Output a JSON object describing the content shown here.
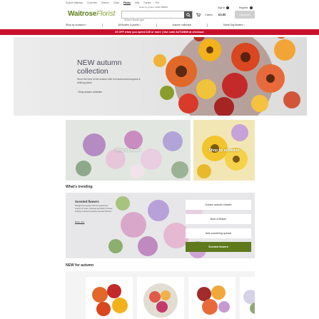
{
  "utility_links": [
    "Explore Waitrose",
    "Groceries",
    "Kitchen",
    "Cellar",
    "Florist",
    "Gifts",
    "Garden",
    "Pet"
  ],
  "utility_active_index": 4,
  "header": {
    "logo_main": "Waitrose",
    "logo_sub": "Florist",
    "order_phone": "Order by phone: 0800 188881",
    "search_placeholder": "Search flower type",
    "items_label": "0 items",
    "basket_total": "£0.00",
    "checkout_label": "Checkout",
    "signin_label": "Sign in",
    "register_label": "Register"
  },
  "nav": {
    "items": [
      {
        "label": "Shop by occasion"
      },
      {
        "label": "All flowers & plants"
      },
      {
        "label": "Autumn collection"
      },
      {
        "label": "Same Day flowers"
      }
    ]
  },
  "promo": "£5 OFF when you spend £35 or more | Use code AUTUMN5 at checkout",
  "hero": {
    "title_line1": "NEW autumn",
    "title_line2": "collection",
    "subtitle": "Send the best of the season with rich autumnal bouquets & striking plants",
    "link": "Shop autumn collection"
  },
  "tiles": [
    {
      "label": "Shop by flower"
    },
    {
      "label": "Shop by occasion"
    }
  ],
  "trending": {
    "section_title": "What's trending",
    "card_title": "Scented flowers",
    "card_desc": "Delight the senses with the perfumed scents of roses, freesias and lilies in these striking, heady & popular scented flowers.",
    "shop_now": "Shop now",
    "options": [
      "Golden autumn shades",
      "Best of British",
      "Add something special",
      "Scented flowers"
    ],
    "active_index": 3
  },
  "new_for_autumn": {
    "section_title": "NEW for autumn"
  },
  "colors": {
    "brand_green": "#5e7a1c",
    "promo_red": "#c8102e"
  }
}
